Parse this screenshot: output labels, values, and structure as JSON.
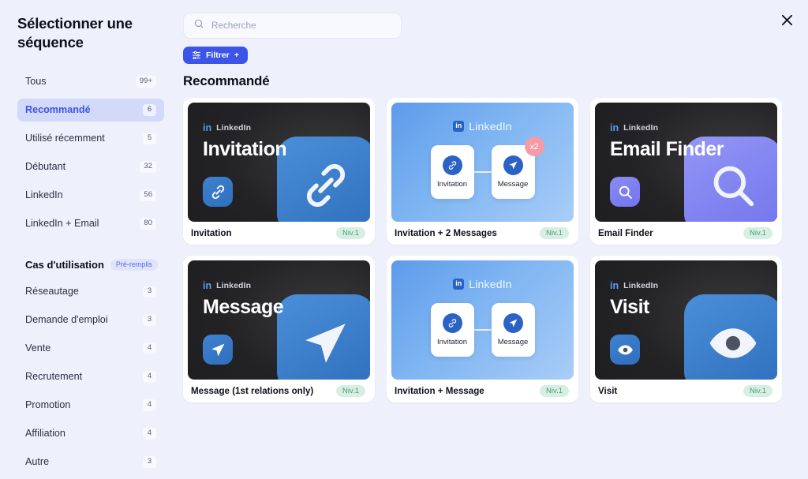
{
  "sidebar": {
    "title": "Sélectionner une séquence",
    "filters": [
      {
        "label": "Tous",
        "count": "99+",
        "active": false
      },
      {
        "label": "Recommandé",
        "count": "6",
        "active": true
      },
      {
        "label": "Utilisé récemment",
        "count": "5",
        "active": false
      },
      {
        "label": "Débutant",
        "count": "32",
        "active": false
      },
      {
        "label": "LinkedIn",
        "count": "56",
        "active": false
      },
      {
        "label": "LinkedIn + Email",
        "count": "80",
        "active": false
      }
    ],
    "use_case_section": {
      "title": "Cas d'utilisation",
      "badge": "Pré-remplis",
      "items": [
        {
          "label": "Réseautage",
          "count": "3"
        },
        {
          "label": "Demande d'emploi",
          "count": "3"
        },
        {
          "label": "Vente",
          "count": "4"
        },
        {
          "label": "Recrutement",
          "count": "4"
        },
        {
          "label": "Promotion",
          "count": "4"
        },
        {
          "label": "Affiliation",
          "count": "4"
        },
        {
          "label": "Autre",
          "count": "3"
        }
      ]
    }
  },
  "toolbar": {
    "search_placeholder": "Recherche",
    "search_value": "",
    "filter_label": "Filtrer",
    "filter_plus": "+",
    "close_label": "✕"
  },
  "main": {
    "section_title": "Recommandé",
    "cards": [
      {
        "name": "Invitation",
        "level": "Niv.1",
        "style": "dark",
        "network": "LinkedIn",
        "thumb_title": "Invitation",
        "icon": "link-icon",
        "icon_color": "blue"
      },
      {
        "name": "Invitation + 2 Messages",
        "level": "Niv.1",
        "style": "flow",
        "network": "LinkedIn",
        "steps": [
          {
            "label": "Invitation",
            "icon": "link-icon"
          },
          {
            "label": "Message",
            "icon": "send-icon",
            "badge": "x2"
          }
        ]
      },
      {
        "name": "Email Finder",
        "level": "Niv.1",
        "style": "dark",
        "network": "LinkedIn",
        "thumb_title": "Email Finder",
        "icon": "magnifier-icon",
        "icon_color": "violet"
      },
      {
        "name": "Message (1st relations only)",
        "level": "Niv.1",
        "style": "dark",
        "network": "LinkedIn",
        "thumb_title": "Message",
        "icon": "send-icon",
        "icon_color": "blue"
      },
      {
        "name": "Invitation + Message",
        "level": "Niv.1",
        "style": "flow",
        "network": "LinkedIn",
        "steps": [
          {
            "label": "Invitation",
            "icon": "link-icon"
          },
          {
            "label": "Message",
            "icon": "send-icon",
            "badge": ""
          }
        ]
      },
      {
        "name": "Visit",
        "level": "Niv.1",
        "style": "dark",
        "network": "LinkedIn",
        "thumb_title": "Visit",
        "icon": "eye-icon",
        "icon_color": "blue"
      }
    ]
  },
  "colors": {
    "accent": "#3c55e8",
    "background": "#eef1fb",
    "level_badge_bg": "#d6efe2",
    "level_badge_text": "#4e9b7e",
    "x_badge_bg": "#f59ba8"
  }
}
